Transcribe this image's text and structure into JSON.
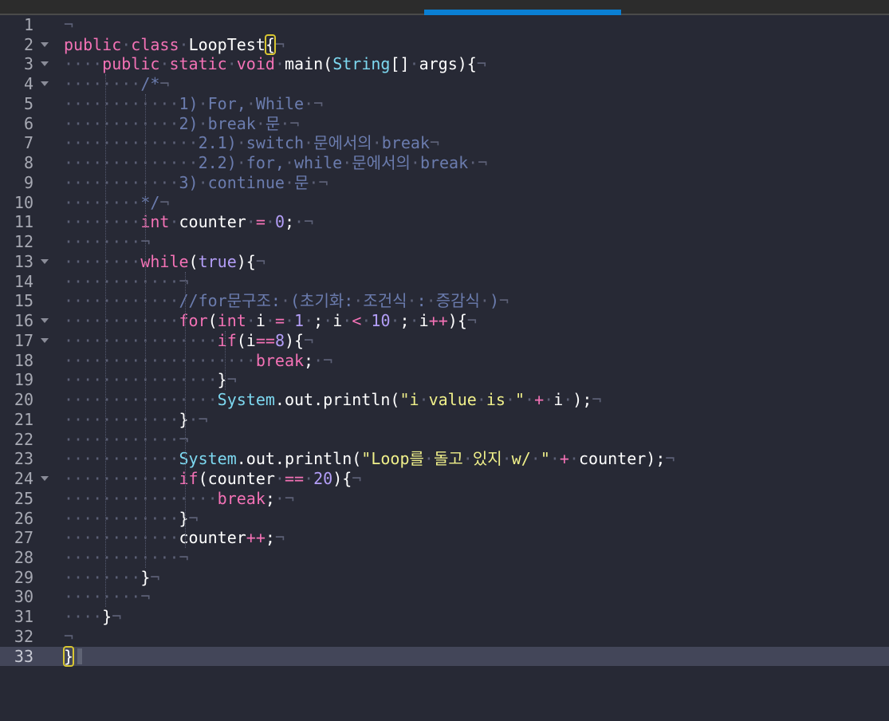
{
  "editor": {
    "language": "java",
    "current_line": 33,
    "colors": {
      "background": "#272935",
      "keyword": "#f472b6",
      "type": "#7dd8f0",
      "number": "#b39ef7",
      "string": "#f0f08a",
      "comment": "#6b7cae",
      "whitespace_marker": "#5c6076",
      "bracket_match": "#d8c632",
      "tab_indicator": "#0a7fd4"
    },
    "lines": [
      {
        "n": "1",
        "tokens": [
          [
            "pil",
            "¬"
          ]
        ]
      },
      {
        "n": "2",
        "fold": true,
        "tokens": [
          [
            "kw",
            "public"
          ],
          [
            "ws",
            "·"
          ],
          [
            "kw",
            "class"
          ],
          [
            "ws",
            "·"
          ],
          [
            "pn",
            "LoopTest"
          ],
          [
            "bm",
            "{"
          ],
          [
            "pil",
            "¬"
          ]
        ]
      },
      {
        "n": "3",
        "fold": true,
        "tokens": [
          [
            "ws",
            "····"
          ],
          [
            "kw",
            "public"
          ],
          [
            "ws",
            "·"
          ],
          [
            "kw",
            "static"
          ],
          [
            "ws",
            "·"
          ],
          [
            "kw",
            "void"
          ],
          [
            "ws",
            "·"
          ],
          [
            "pn",
            "main("
          ],
          [
            "ty",
            "String"
          ],
          [
            "pn",
            "[]"
          ],
          [
            "ws",
            "·"
          ],
          [
            "pn",
            "args){"
          ],
          [
            "pil",
            "¬"
          ]
        ]
      },
      {
        "n": "4",
        "fold": true,
        "tokens": [
          [
            "ws",
            "········"
          ],
          [
            "cmt",
            "/*"
          ],
          [
            "pil",
            "¬"
          ]
        ]
      },
      {
        "n": "5",
        "tokens": [
          [
            "ws",
            "············"
          ],
          [
            "cmt",
            "1)"
          ],
          [
            "ws",
            "·"
          ],
          [
            "cmt",
            "For,"
          ],
          [
            "ws",
            "·"
          ],
          [
            "cmt",
            "While"
          ],
          [
            "ws",
            "·"
          ],
          [
            "pil",
            "¬"
          ]
        ]
      },
      {
        "n": "6",
        "tokens": [
          [
            "ws",
            "············"
          ],
          [
            "cmt",
            "2)"
          ],
          [
            "ws",
            "·"
          ],
          [
            "cmt",
            "break"
          ],
          [
            "ws",
            "·"
          ],
          [
            "cmt",
            "문"
          ],
          [
            "ws",
            "·"
          ],
          [
            "pil",
            "¬"
          ]
        ]
      },
      {
        "n": "7",
        "tokens": [
          [
            "ws",
            "··············"
          ],
          [
            "cmt",
            "2.1)"
          ],
          [
            "ws",
            "·"
          ],
          [
            "cmt",
            "switch"
          ],
          [
            "ws",
            "·"
          ],
          [
            "cmt",
            "문에서의"
          ],
          [
            "ws",
            "·"
          ],
          [
            "cmt",
            "break"
          ],
          [
            "pil",
            "¬"
          ]
        ]
      },
      {
        "n": "8",
        "tokens": [
          [
            "ws",
            "··············"
          ],
          [
            "cmt",
            "2.2)"
          ],
          [
            "ws",
            "·"
          ],
          [
            "cmt",
            "for,"
          ],
          [
            "ws",
            "·"
          ],
          [
            "cmt",
            "while"
          ],
          [
            "ws",
            "·"
          ],
          [
            "cmt",
            "문에서의"
          ],
          [
            "ws",
            "·"
          ],
          [
            "cmt",
            "break"
          ],
          [
            "ws",
            "·"
          ],
          [
            "pil",
            "¬"
          ]
        ]
      },
      {
        "n": "9",
        "tokens": [
          [
            "ws",
            "············"
          ],
          [
            "cmt",
            "3)"
          ],
          [
            "ws",
            "·"
          ],
          [
            "cmt",
            "continue"
          ],
          [
            "ws",
            "·"
          ],
          [
            "cmt",
            "문"
          ],
          [
            "ws",
            "·"
          ],
          [
            "pil",
            "¬"
          ]
        ]
      },
      {
        "n": "10",
        "tokens": [
          [
            "ws",
            "········"
          ],
          [
            "cmt",
            "*/"
          ],
          [
            "pil",
            "¬"
          ]
        ]
      },
      {
        "n": "11",
        "tokens": [
          [
            "ws",
            "········"
          ],
          [
            "kw",
            "int"
          ],
          [
            "ws",
            "·"
          ],
          [
            "pn",
            "counter"
          ],
          [
            "ws",
            "·"
          ],
          [
            "op",
            "="
          ],
          [
            "ws",
            "·"
          ],
          [
            "num",
            "0"
          ],
          [
            "pn",
            ";"
          ],
          [
            "ws",
            "·"
          ],
          [
            "pil",
            "¬"
          ]
        ]
      },
      {
        "n": "12",
        "tokens": [
          [
            "ws",
            "········"
          ],
          [
            "pil",
            "¬"
          ]
        ]
      },
      {
        "n": "13",
        "fold": true,
        "tokens": [
          [
            "ws",
            "········"
          ],
          [
            "kw",
            "while"
          ],
          [
            "pn",
            "("
          ],
          [
            "num",
            "true"
          ],
          [
            "pn",
            "){"
          ],
          [
            "pil",
            "¬"
          ]
        ]
      },
      {
        "n": "14",
        "tokens": [
          [
            "ws",
            "············"
          ],
          [
            "pil",
            "¬"
          ]
        ]
      },
      {
        "n": "15",
        "tokens": [
          [
            "ws",
            "············"
          ],
          [
            "cmt",
            "//for문구조:"
          ],
          [
            "ws",
            "·"
          ],
          [
            "cmt",
            "(초기화:"
          ],
          [
            "ws",
            "·"
          ],
          [
            "cmt",
            "조건식"
          ],
          [
            "ws",
            "·"
          ],
          [
            "cmt",
            ":"
          ],
          [
            "ws",
            "·"
          ],
          [
            "cmt",
            "증감식"
          ],
          [
            "ws",
            "·"
          ],
          [
            "cmt",
            ")"
          ],
          [
            "pil",
            "¬"
          ]
        ]
      },
      {
        "n": "16",
        "fold": true,
        "tokens": [
          [
            "ws",
            "············"
          ],
          [
            "kw",
            "for"
          ],
          [
            "pn",
            "("
          ],
          [
            "kw",
            "int"
          ],
          [
            "ws",
            "·"
          ],
          [
            "pn",
            "i"
          ],
          [
            "ws",
            "·"
          ],
          [
            "op",
            "="
          ],
          [
            "ws",
            "·"
          ],
          [
            "num",
            "1"
          ],
          [
            "ws",
            "·"
          ],
          [
            "pn",
            ";"
          ],
          [
            "ws",
            "·"
          ],
          [
            "pn",
            "i"
          ],
          [
            "ws",
            "·"
          ],
          [
            "op",
            "<"
          ],
          [
            "ws",
            "·"
          ],
          [
            "num",
            "10"
          ],
          [
            "ws",
            "·"
          ],
          [
            "pn",
            ";"
          ],
          [
            "ws",
            "·"
          ],
          [
            "pn",
            "i"
          ],
          [
            "op",
            "++"
          ],
          [
            "pn",
            "){"
          ],
          [
            "pil",
            "¬"
          ]
        ]
      },
      {
        "n": "17",
        "fold": true,
        "tokens": [
          [
            "ws",
            "················"
          ],
          [
            "kw",
            "if"
          ],
          [
            "pn",
            "(i"
          ],
          [
            "op",
            "=="
          ],
          [
            "num",
            "8"
          ],
          [
            "pn",
            "){"
          ],
          [
            "pil",
            "¬"
          ]
        ]
      },
      {
        "n": "18",
        "tokens": [
          [
            "ws",
            "····················"
          ],
          [
            "kw",
            "break"
          ],
          [
            "pn",
            ";"
          ],
          [
            "ws",
            "·"
          ],
          [
            "pil",
            "¬"
          ]
        ]
      },
      {
        "n": "19",
        "tokens": [
          [
            "ws",
            "················"
          ],
          [
            "pn",
            "}"
          ],
          [
            "pil",
            "¬"
          ]
        ]
      },
      {
        "n": "20",
        "tokens": [
          [
            "ws",
            "················"
          ],
          [
            "ty",
            "System"
          ],
          [
            "pn",
            ".out.println("
          ],
          [
            "str",
            "\"i"
          ],
          [
            "ws",
            "·"
          ],
          [
            "str",
            "value"
          ],
          [
            "ws",
            "·"
          ],
          [
            "str",
            "is"
          ],
          [
            "ws",
            "·"
          ],
          [
            "str",
            "\""
          ],
          [
            "ws",
            "·"
          ],
          [
            "op",
            "+"
          ],
          [
            "ws",
            "·"
          ],
          [
            "pn",
            "i"
          ],
          [
            "ws",
            "·"
          ],
          [
            "pn",
            ");"
          ],
          [
            "pil",
            "¬"
          ]
        ]
      },
      {
        "n": "21",
        "tokens": [
          [
            "ws",
            "············"
          ],
          [
            "pn",
            "}"
          ],
          [
            "ws",
            "·"
          ],
          [
            "pil",
            "¬"
          ]
        ]
      },
      {
        "n": "22",
        "tokens": [
          [
            "ws",
            "············"
          ],
          [
            "pil",
            "¬"
          ]
        ]
      },
      {
        "n": "23",
        "tokens": [
          [
            "ws",
            "············"
          ],
          [
            "ty",
            "System"
          ],
          [
            "pn",
            ".out.println("
          ],
          [
            "str",
            "\"Loop를"
          ],
          [
            "ws",
            "·"
          ],
          [
            "str",
            "돌고"
          ],
          [
            "ws",
            "·"
          ],
          [
            "str",
            "있지"
          ],
          [
            "ws",
            "·"
          ],
          [
            "str",
            "w/"
          ],
          [
            "ws",
            "·"
          ],
          [
            "str",
            "\""
          ],
          [
            "ws",
            "·"
          ],
          [
            "op",
            "+"
          ],
          [
            "ws",
            "·"
          ],
          [
            "pn",
            "counter);"
          ],
          [
            "pil",
            "¬"
          ]
        ]
      },
      {
        "n": "24",
        "fold": true,
        "tokens": [
          [
            "ws",
            "············"
          ],
          [
            "kw",
            "if"
          ],
          [
            "pn",
            "(counter"
          ],
          [
            "ws",
            "·"
          ],
          [
            "op",
            "=="
          ],
          [
            "ws",
            "·"
          ],
          [
            "num",
            "20"
          ],
          [
            "pn",
            "){"
          ],
          [
            "pil",
            "¬"
          ]
        ]
      },
      {
        "n": "25",
        "tokens": [
          [
            "ws",
            "················"
          ],
          [
            "kw",
            "break"
          ],
          [
            "pn",
            ";"
          ],
          [
            "ws",
            "·"
          ],
          [
            "pil",
            "¬"
          ]
        ]
      },
      {
        "n": "26",
        "tokens": [
          [
            "ws",
            "············"
          ],
          [
            "pn",
            "}"
          ],
          [
            "pil",
            "¬"
          ]
        ]
      },
      {
        "n": "27",
        "tokens": [
          [
            "ws",
            "············"
          ],
          [
            "pn",
            "counter"
          ],
          [
            "op",
            "++"
          ],
          [
            "pn",
            ";"
          ],
          [
            "pil",
            "¬"
          ]
        ]
      },
      {
        "n": "28",
        "tokens": [
          [
            "ws",
            "············"
          ],
          [
            "pil",
            "¬"
          ]
        ]
      },
      {
        "n": "29",
        "tokens": [
          [
            "ws",
            "········"
          ],
          [
            "pn",
            "}"
          ],
          [
            "pil",
            "¬"
          ]
        ]
      },
      {
        "n": "30",
        "tokens": [
          [
            "ws",
            "········"
          ],
          [
            "pil",
            "¬"
          ]
        ]
      },
      {
        "n": "31",
        "tokens": [
          [
            "ws",
            "····"
          ],
          [
            "pn",
            "}"
          ],
          [
            "pil",
            "¬"
          ]
        ]
      },
      {
        "n": "32",
        "tokens": [
          [
            "pil",
            "¬"
          ]
        ]
      },
      {
        "n": "33",
        "tokens": [
          [
            "bm",
            "}"
          ]
        ]
      }
    ]
  }
}
